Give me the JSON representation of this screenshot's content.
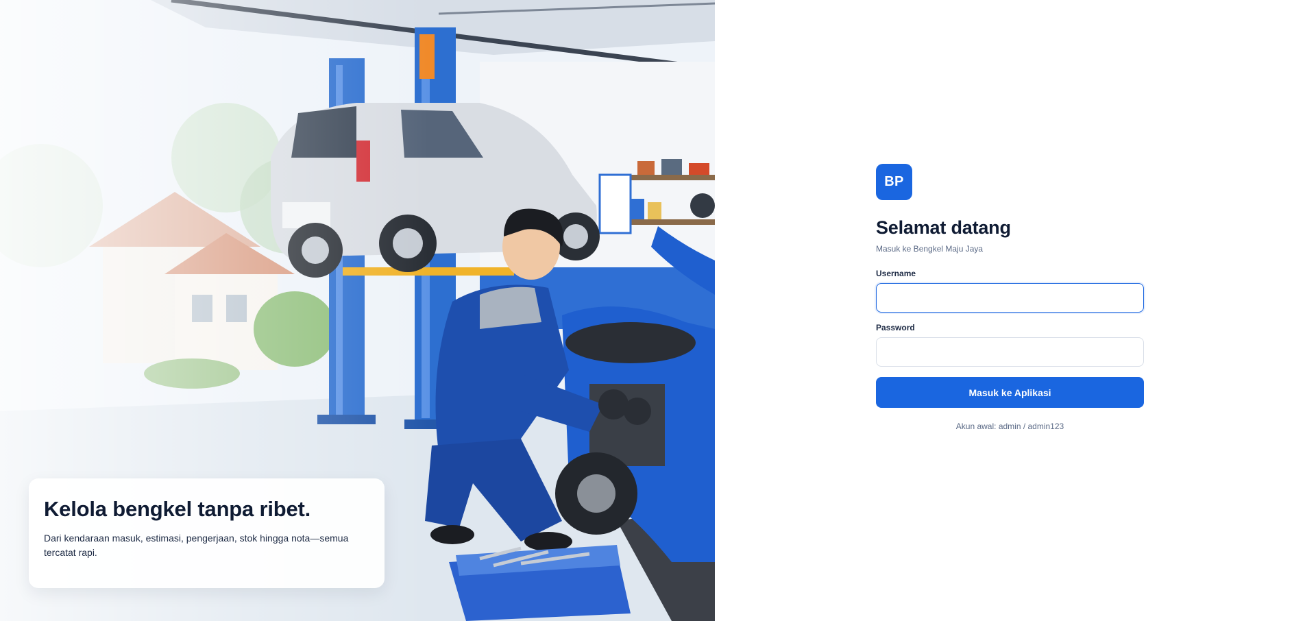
{
  "hero": {
    "title": "Kelola bengkel tanpa ribet.",
    "description": "Dari kendaraan masuk, estimasi, pengerjaan, stok hingga nota—semua tercatat rapi."
  },
  "login": {
    "brand_initials": "BP",
    "heading": "Selamat datang",
    "subtitle": "Masuk ke Bengkel Maju Jaya",
    "username_label": "Username",
    "username_value": "",
    "password_label": "Password",
    "password_value": "",
    "submit_label": "Masuk ke Aplikasi",
    "hint": "Akun awal: admin / admin123"
  },
  "colors": {
    "accent": "#1a66e0",
    "text_dark": "#0f1b33",
    "text_muted": "#5b6a86"
  }
}
